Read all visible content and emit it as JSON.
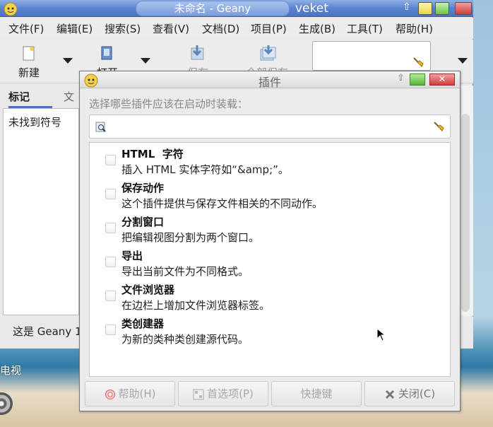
{
  "main_window": {
    "title": "未命名 - Geany",
    "user": "veket",
    "menu": [
      "文件(F)",
      "编辑(E)",
      "搜索(S)",
      "查看(V)",
      "文档(D)",
      "项目(P)",
      "生成(B)",
      "工具(T)",
      "帮助(H)"
    ],
    "toolbar": {
      "new_label": "新建",
      "open_label": "打开",
      "save_label": "保存",
      "save_all_label": "全部保存"
    },
    "sidebar": {
      "tabs": [
        "标记",
        "文档"
      ],
      "empty_text": "未找到符号"
    },
    "status_text": "这是 Geany 1"
  },
  "desktop": {
    "label": "电视"
  },
  "dialog": {
    "title": "插件",
    "instruction": "选择哪些插件应该在启动时装载：",
    "filter_value": "",
    "plugins": [
      {
        "name": "HTML  字符",
        "description": "插入 HTML 实体字符如“&amp;”。",
        "enabled": false
      },
      {
        "name": "保存动作",
        "description": "这个插件提供与保存文件相关的不同动作。",
        "enabled": false
      },
      {
        "name": "分割窗口",
        "description": "把编辑视图分割为两个窗口。",
        "enabled": false
      },
      {
        "name": "导出",
        "description": "导出当前文件为不同格式。",
        "enabled": false
      },
      {
        "name": "文件浏览器",
        "description": "在边栏上增加文件浏览器标签。",
        "enabled": false
      },
      {
        "name": "类创建器",
        "description": "为新的类种类创建源代码。",
        "enabled": false
      }
    ],
    "buttons": {
      "help": "帮助(H)",
      "preferences": "首选项(P)",
      "keybindings": "快捷键",
      "close": "关闭(C)"
    }
  },
  "colors": {
    "titlebar_blue": "#5b84cf",
    "dialog_bg": "#ebebeb",
    "disabled_text": "#a6a6a6"
  }
}
